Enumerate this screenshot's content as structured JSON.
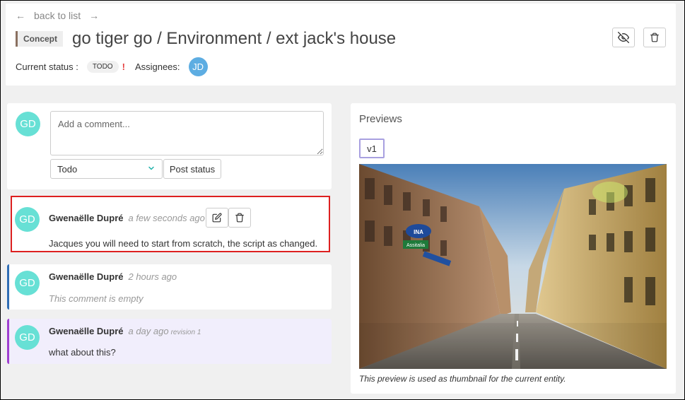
{
  "nav": {
    "back_label": "back to list",
    "back_arrow": "←",
    "forward_arrow": "→"
  },
  "entity": {
    "type": "Concept",
    "title": "go tiger go / Environment / ext jack's house",
    "status_label": "Current status :",
    "status": "TODO",
    "priority_mark": "!",
    "assignees_label": "Assignees:",
    "assignee_initials": "JD"
  },
  "new_comment": {
    "avatar_initials": "GD",
    "placeholder": "Add a comment...",
    "status_value": "Todo",
    "post_label": "Post status"
  },
  "comments": [
    {
      "initials": "GD",
      "author": "Gwenaëlle Dupré",
      "date": "a few seconds ago",
      "revision": "",
      "text": "Jacques you will need to start from scratch, the script as changed."
    },
    {
      "initials": "GD",
      "author": "Gwenaëlle Dupré",
      "date": "2 hours ago",
      "revision": "",
      "text": "This comment is empty"
    },
    {
      "initials": "GD",
      "author": "Gwenaëlle Dupré",
      "date": "a day ago",
      "revision": "revision 1",
      "text": "what about this?"
    }
  ],
  "previews": {
    "title": "Previews",
    "revision_tab": "v1",
    "caption": "This preview is used as thumbnail for the current entity.",
    "sign_text": "Assitalia"
  },
  "colors": {
    "avatar_gd": "#67e0d5",
    "avatar_jd": "#5dade2",
    "highlight_border": "#dd2020",
    "todo_stripe": "#2f6db5",
    "revision_stripe": "#a040d0",
    "revision_bg": "#f1eefc"
  }
}
